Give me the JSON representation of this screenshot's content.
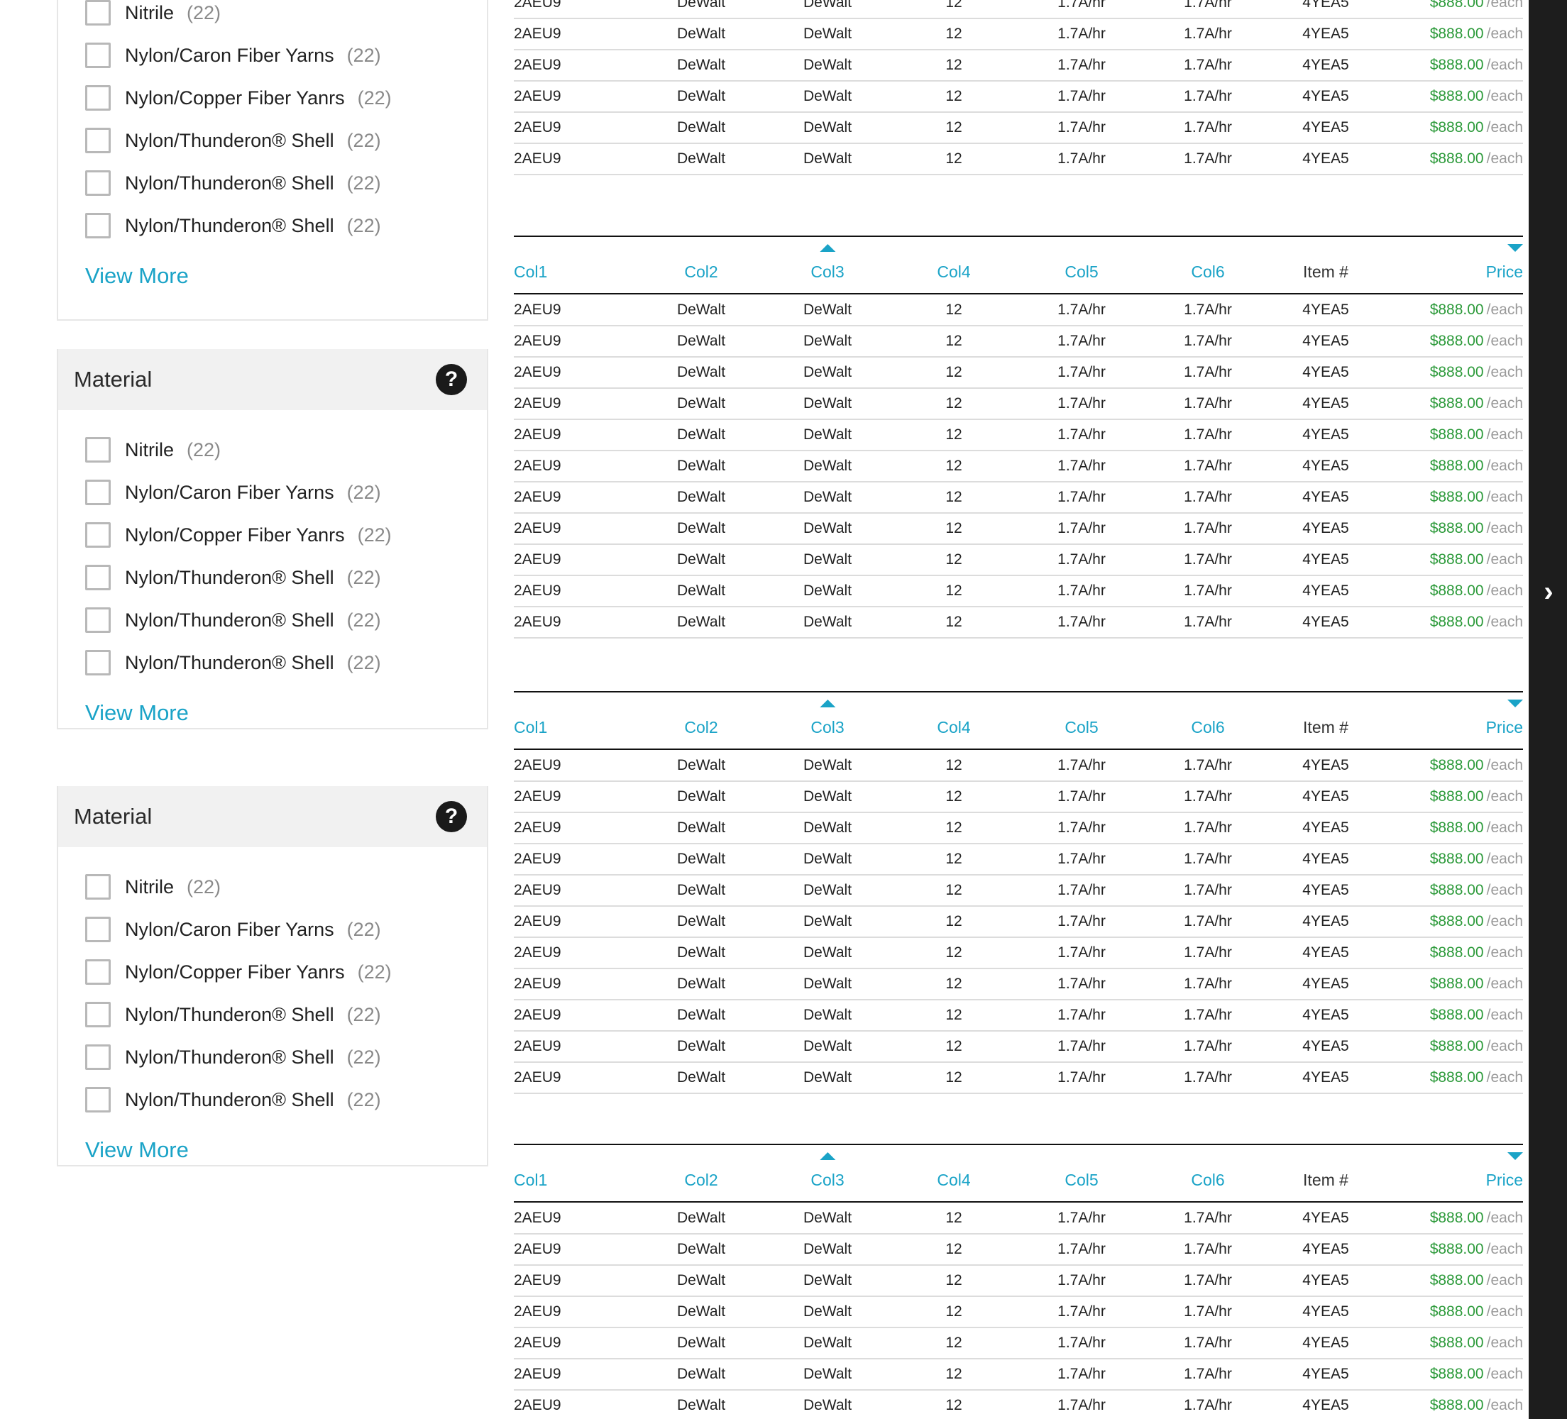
{
  "facets": [
    {
      "title": "",
      "options": [
        {
          "label": "Nitrile",
          "count": "(22)"
        },
        {
          "label": "Nylon/Caron Fiber Yarns",
          "count": "(22)"
        },
        {
          "label": "Nylon/Copper Fiber Yanrs",
          "count": "(22)"
        },
        {
          "label": "Nylon/Thunderon® Shell",
          "count": "(22)"
        },
        {
          "label": "Nylon/Thunderon® Shell",
          "count": "(22)"
        },
        {
          "label": "Nylon/Thunderon® Shell",
          "count": "(22)"
        }
      ],
      "view_more": "View More"
    },
    {
      "title": "Material",
      "help": "?",
      "options": [
        {
          "label": "Nitrile",
          "count": "(22)"
        },
        {
          "label": "Nylon/Caron Fiber Yarns",
          "count": "(22)"
        },
        {
          "label": "Nylon/Copper Fiber Yanrs",
          "count": "(22)"
        },
        {
          "label": "Nylon/Thunderon® Shell",
          "count": "(22)"
        },
        {
          "label": "Nylon/Thunderon® Shell",
          "count": "(22)"
        },
        {
          "label": "Nylon/Thunderon® Shell",
          "count": "(22)"
        }
      ],
      "view_more": "View More"
    },
    {
      "title": "Material",
      "help": "?",
      "options": [
        {
          "label": "Nitrile",
          "count": "(22)"
        },
        {
          "label": "Nylon/Caron Fiber Yarns",
          "count": "(22)"
        },
        {
          "label": "Nylon/Copper Fiber Yanrs",
          "count": "(22)"
        },
        {
          "label": "Nylon/Thunderon® Shell",
          "count": "(22)"
        },
        {
          "label": "Nylon/Thunderon® Shell",
          "count": "(22)"
        },
        {
          "label": "Nylon/Thunderon® Shell",
          "count": "(22)"
        }
      ],
      "view_more": "View More"
    }
  ],
  "table_headers": [
    "Col1",
    "Col2",
    "Col3",
    "Col4",
    "Col5",
    "Col6",
    "Item #",
    "Price"
  ],
  "row": {
    "col1": "2AEU9",
    "col2": "DeWalt",
    "col3": "DeWalt",
    "col4": "12",
    "col5": "1.7A/hr",
    "col6": "1.7A/hr",
    "item": "4YEA5",
    "price": "$888.00",
    "per": "/each"
  },
  "tables": [
    {
      "header": false,
      "rows": 6
    },
    {
      "header": true,
      "rows": 11
    },
    {
      "header": true,
      "rows": 11
    },
    {
      "header": true,
      "rows": 7
    }
  ],
  "rail": {
    "arrow": "›"
  },
  "colors": {
    "accent": "#1aa3c7",
    "price": "#2c9a3a",
    "rail": "#1d1d1d"
  }
}
